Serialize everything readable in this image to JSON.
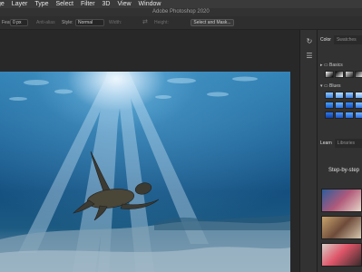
{
  "menu": [
    "ge",
    "Layer",
    "Type",
    "Select",
    "Filter",
    "3D",
    "View",
    "Window"
  ],
  "title": "Adobe Photoshop 2020",
  "options": {
    "feather_label": "Feather:",
    "feather_value": "0 px",
    "antialias_label": "Anti-alias",
    "style_label": "Style:",
    "style_value": "Normal",
    "width_label": "Width:",
    "height_label": "Height:",
    "select_mask_label": "Select and Mask..."
  },
  "right_panel": {
    "tabs_top": [
      "Color",
      "Swatches"
    ],
    "groups": [
      {
        "label": "Basics"
      },
      {
        "label": "Blues"
      }
    ],
    "tabs_mid": [
      "Learn",
      "Libraries"
    ],
    "learn_heading": "Step-by-step"
  },
  "colors": {
    "accent": "#1e78c8"
  }
}
